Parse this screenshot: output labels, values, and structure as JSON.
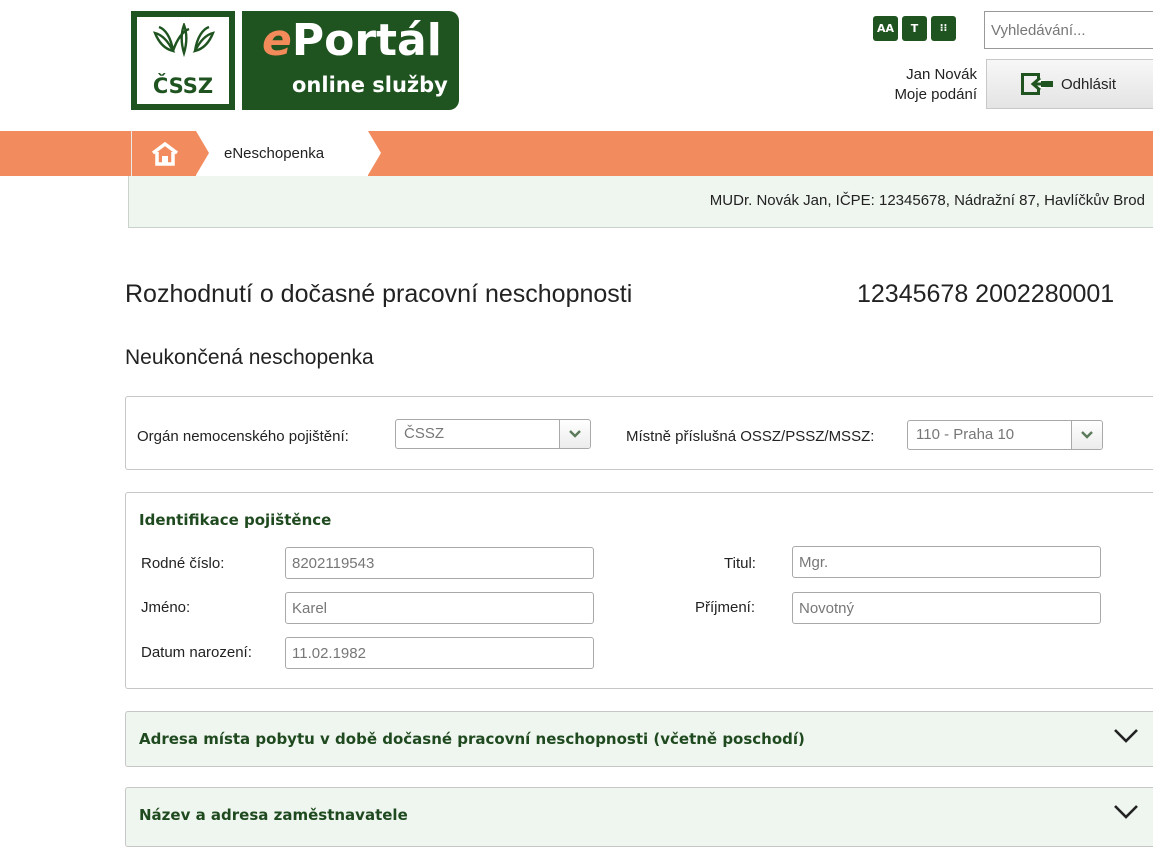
{
  "logo": {
    "cssz_text": "ČSSZ",
    "portal_prefix": "e",
    "portal_name": "Portál",
    "portal_subtitle": "online služby"
  },
  "toolbar": {
    "font_size_button": "AA",
    "text_button": "T",
    "structure_button": "⁝⁝",
    "search_placeholder": "Vyhledávání..."
  },
  "user": {
    "name": "Jan Novák",
    "submissions_link": "Moje podání",
    "logout_label": "Odhlásit"
  },
  "breadcrumb": {
    "home_icon": "home-icon",
    "current": "eNeschopenka"
  },
  "doctor_info": "MUDr. Novák Jan, IČPE: 12345678, Nádražní 87, Havlíčkův Brod",
  "page": {
    "title": "Rozhodnutí o dočasné pracovní neschopnosti",
    "number": "12345678 2002280001",
    "subtitle": "Neukončená neschopenka"
  },
  "insurance": {
    "organ_label": "Orgán nemocenského pojištění:",
    "organ_value": "ČSSZ",
    "office_label": "Místně příslušná OSSZ/PSSZ/MSSZ:",
    "office_value": "110 - Praha 10"
  },
  "insured": {
    "section_title": "Identifikace pojištěnce",
    "birth_number_label": "Rodné číslo:",
    "birth_number_value": "8202119543",
    "title_label": "Titul:",
    "title_value": "Mgr.",
    "first_name_label": "Jméno:",
    "first_name_value": "Karel",
    "last_name_label": "Příjmení:",
    "last_name_value": "Novotný",
    "birth_date_label": "Datum narození:",
    "birth_date_value": "11.02.1982"
  },
  "accordions": [
    {
      "title": "Adresa místa pobytu v době dočasné pracovní neschopnosti (včetně poschodí)"
    },
    {
      "title": "Název a adresa zaměstnavatele"
    }
  ],
  "colors": {
    "brand_green": "#1f5420",
    "accent_orange": "#f28c5e",
    "panel_tint": "#eff5ef"
  }
}
